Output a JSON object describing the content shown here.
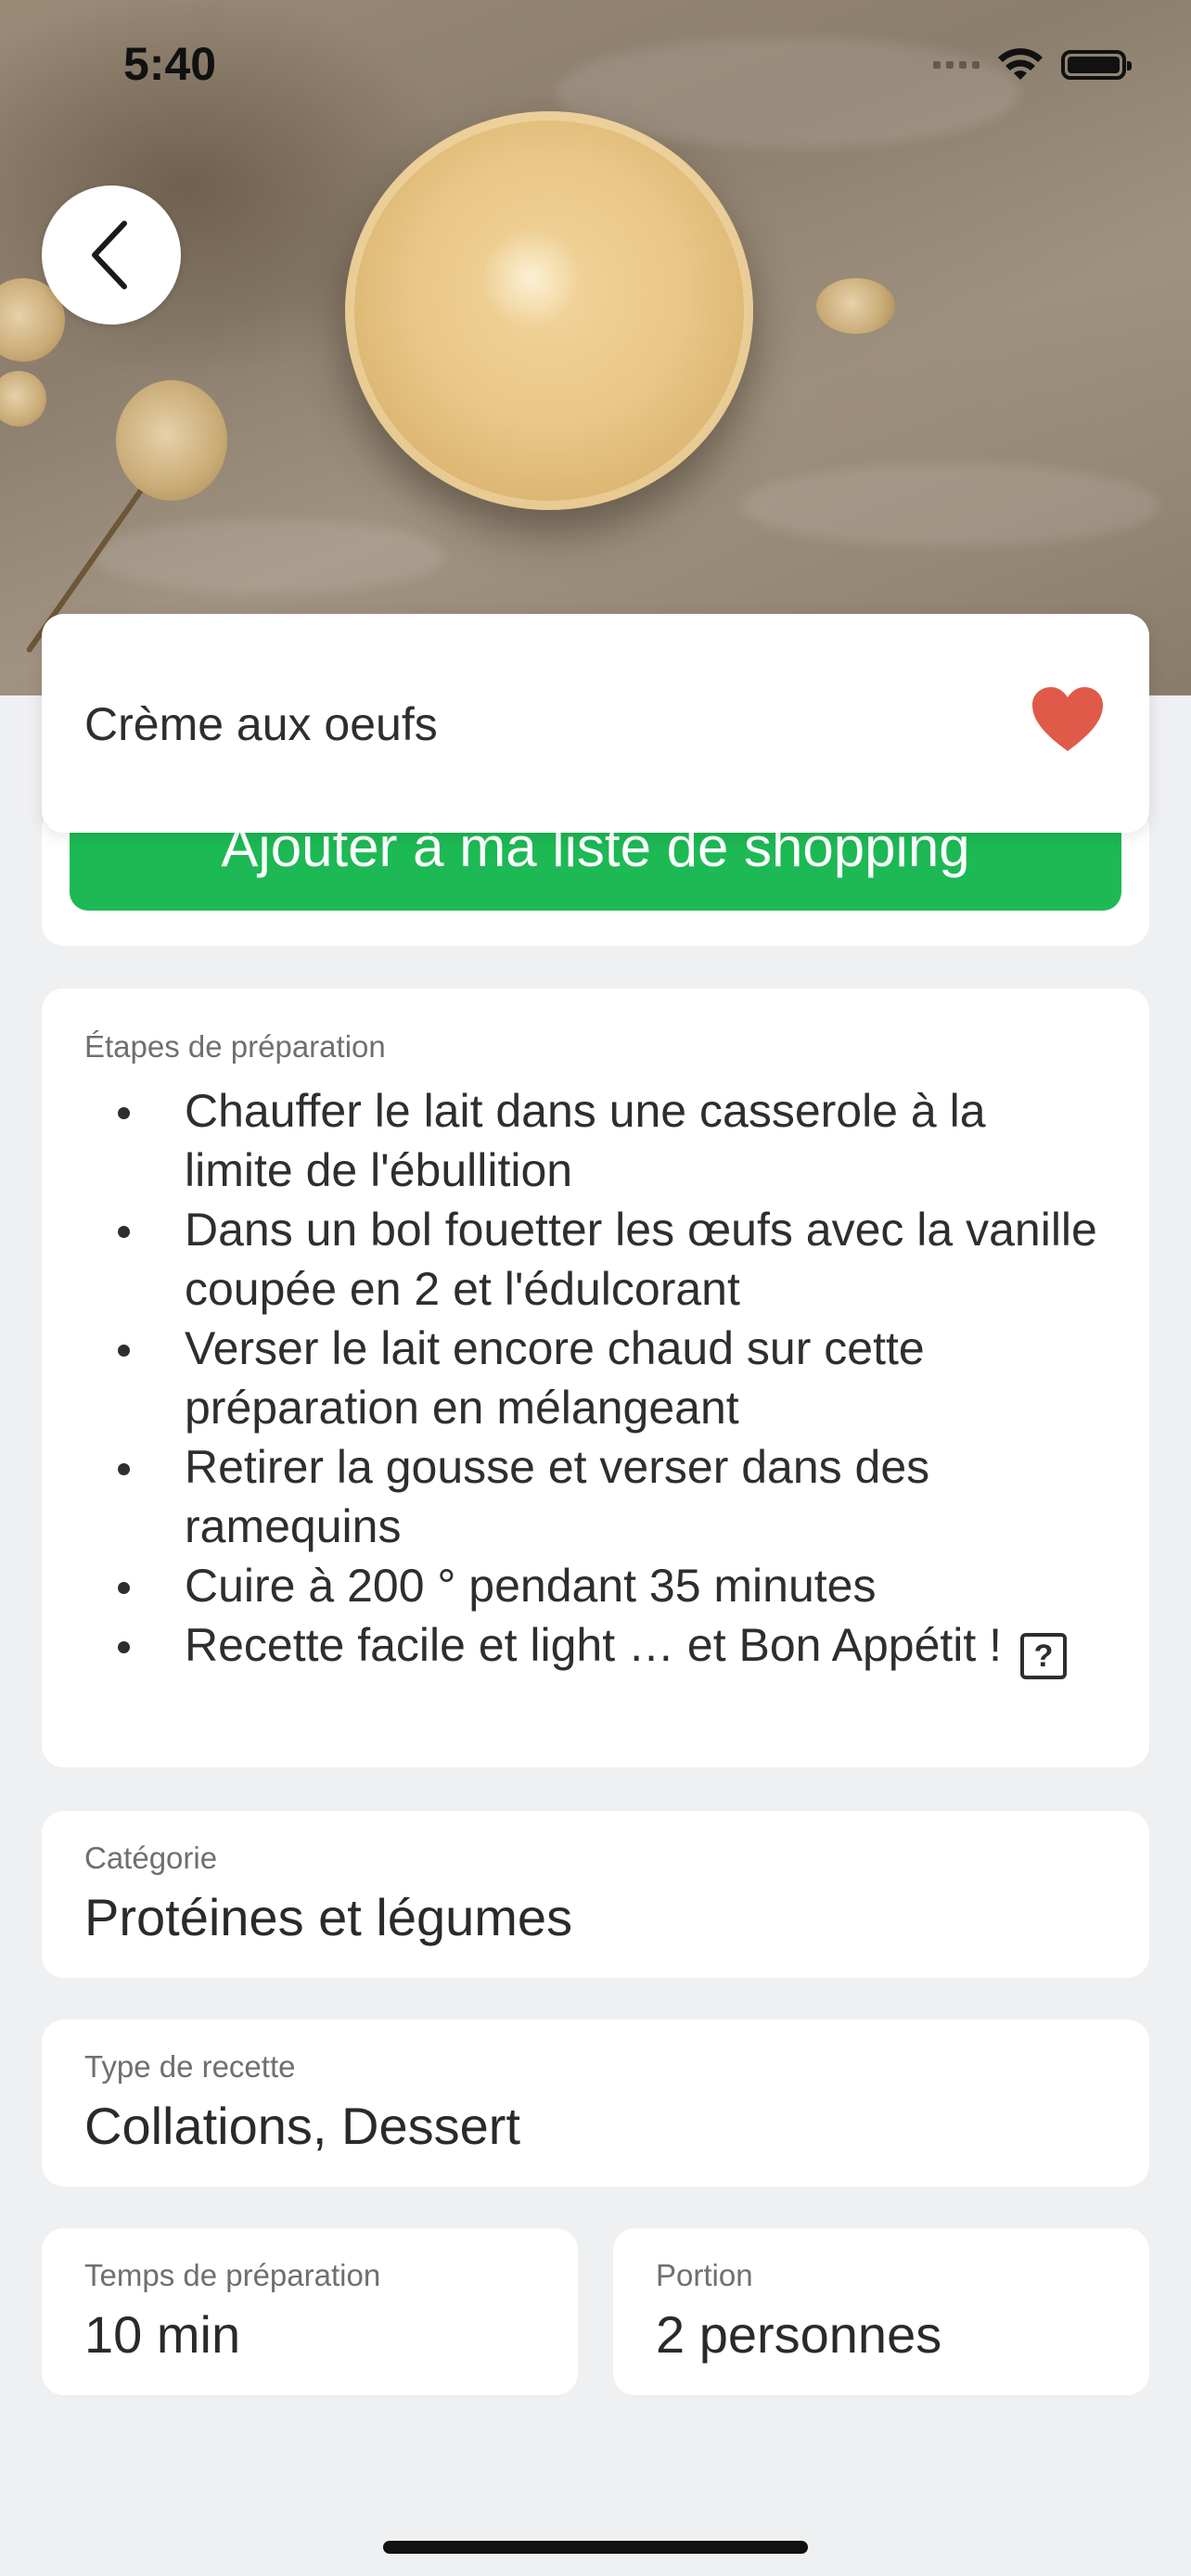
{
  "status_bar": {
    "time": "5:40"
  },
  "recipe": {
    "title": "Crème aux oeufs",
    "favorited": true
  },
  "shopping": {
    "button_label": "Ajouter à ma liste de shopping"
  },
  "steps": {
    "label": "Étapes de préparation",
    "items": [
      "Chauffer le lait dans une casserole à la limite de l'ébullition",
      "Dans un bol fouetter les œufs avec la vanille coupée en 2 et l'édulcorant",
      "Verser le lait encore chaud sur cette préparation en mélangeant",
      "Retirer la gousse et verser dans des ramequins",
      "Cuire à 200 ° pendant 35 minutes",
      "Recette facile et light … et Bon Appétit !"
    ],
    "last_item_glyph": "?"
  },
  "category": {
    "label": "Catégorie",
    "value": "Protéines et légumes"
  },
  "recipe_type": {
    "label": "Type de recette",
    "value": "Collations, Dessert"
  },
  "prep_time": {
    "label": "Temps de préparation",
    "value": "10 min"
  },
  "portion": {
    "label": "Portion",
    "value": "2 personnes"
  },
  "colors": {
    "accent_green": "#1db954",
    "heart_red": "#e05a4a",
    "background": "#eff0f2"
  }
}
